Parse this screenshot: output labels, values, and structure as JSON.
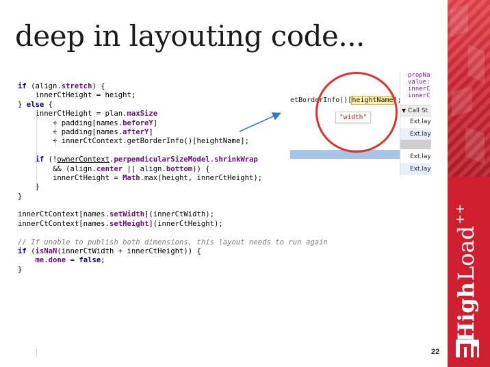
{
  "slide": {
    "title": "deep in layouting code...",
    "page_number": "22"
  },
  "code_lines": [
    [
      {
        "t": "if",
        "s": "k"
      },
      {
        "t": " (align.",
        "s": ""
      },
      {
        "t": "stretch",
        "s": "p"
      },
      {
        "t": ") {",
        "s": ""
      }
    ],
    [
      {
        "t": "    innerCtHeight = height;",
        "s": ""
      }
    ],
    [
      {
        "t": "} ",
        "s": ""
      },
      {
        "t": "else",
        "s": "k"
      },
      {
        "t": " {",
        "s": ""
      }
    ],
    [
      {
        "t": "    innerCtHeight = plan.",
        "s": ""
      },
      {
        "t": "maxSize",
        "s": "p"
      }
    ],
    [
      {
        "t": "        + padding[names.",
        "s": ""
      },
      {
        "t": "beforeY",
        "s": "p"
      },
      {
        "t": "]",
        "s": ""
      }
    ],
    [
      {
        "t": "        + padding[names.",
        "s": ""
      },
      {
        "t": "afterY",
        "s": "p"
      },
      {
        "t": "]",
        "s": ""
      }
    ],
    [
      {
        "t": "        + innerCtContext.getBorderInfo()[heightName];",
        "s": ""
      }
    ],
    [
      {
        "t": "",
        "s": ""
      }
    ],
    [
      {
        "t": "    ",
        "s": ""
      },
      {
        "t": "if",
        "s": "k"
      },
      {
        "t": " (!",
        "s": ""
      },
      {
        "t": "ownerContext",
        "s": "u"
      },
      {
        "t": ".",
        "s": ""
      },
      {
        "t": "perpendicularSizeModel",
        "s": "p"
      },
      {
        "t": ".",
        "s": ""
      },
      {
        "t": "shrinkWrap",
        "s": "p"
      }
    ],
    [
      {
        "t": "        && (align.",
        "s": ""
      },
      {
        "t": "center",
        "s": "p"
      },
      {
        "t": " || align.",
        "s": ""
      },
      {
        "t": "bottom",
        "s": "p"
      },
      {
        "t": ")) {",
        "s": ""
      }
    ],
    [
      {
        "t": "        innerCtHeight = ",
        "s": ""
      },
      {
        "t": "Math",
        "s": "p"
      },
      {
        "t": ".max(height, innerCtHeight);",
        "s": ""
      }
    ],
    [
      {
        "t": "    }",
        "s": ""
      }
    ],
    [
      {
        "t": "}",
        "s": ""
      }
    ],
    [
      {
        "t": "",
        "s": ""
      }
    ],
    [
      {
        "t": "innerCtContext[names.",
        "s": ""
      },
      {
        "t": "setWidth",
        "s": "p"
      },
      {
        "t": "](innerCtWidth);",
        "s": ""
      }
    ],
    [
      {
        "t": "innerCtContext[names.",
        "s": ""
      },
      {
        "t": "setHeight",
        "s": "p"
      },
      {
        "t": "](innerCtHeight);",
        "s": ""
      }
    ],
    [
      {
        "t": "",
        "s": ""
      }
    ],
    [
      {
        "t": "// If unable to publish both dimensions, this layout needs to run again",
        "s": "c"
      }
    ],
    [
      {
        "t": "if",
        "s": "k"
      },
      {
        "t": " (",
        "s": ""
      },
      {
        "t": "isNaN",
        "s": "p"
      },
      {
        "t": "(innerCtWidth + innerCtHeight)) {",
        "s": ""
      }
    ],
    [
      {
        "t": "    ",
        "s": ""
      },
      {
        "t": "me",
        "s": "p"
      },
      {
        "t": ".",
        "s": ""
      },
      {
        "t": "done",
        "s": "p"
      },
      {
        "t": " = ",
        "s": ""
      },
      {
        "t": "false",
        "s": "k"
      },
      {
        "t": ";",
        "s": ""
      }
    ],
    [
      {
        "t": "}",
        "s": ""
      }
    ]
  ],
  "devtools": {
    "expression_prefix": "etBorderInfo()[",
    "expression_highlight": "heightName",
    "expression_suffix": "];",
    "tooltip_value": "\"width\"",
    "scope_lines": [
      {
        "text": "propNa",
        "color": "#881391"
      },
      {
        "text": "value:",
        "color": "#881391"
      },
      {
        "text": "innerC",
        "color": "#881391"
      },
      {
        "text": "innerC",
        "color": "#881391"
      }
    ],
    "call_stack_label": "Call St",
    "stack_rows": [
      {
        "text": "Ext.lay",
        "selected": false
      },
      {
        "text": "Ext.lay",
        "selected": true
      },
      {
        "text": "Ext.lay",
        "selected": false
      },
      {
        "text": "Ext.lay",
        "selected": true
      }
    ]
  },
  "brand": {
    "name_bold": "High",
    "name_regular": "Load",
    "suffix": "++",
    "accent_color": "#cf1f2e"
  },
  "colors": {
    "keyword": "#000080",
    "property": "#660e7a",
    "comment": "#7a7a7a",
    "arrow": "#3a78c2",
    "callout": "#e0302c"
  }
}
